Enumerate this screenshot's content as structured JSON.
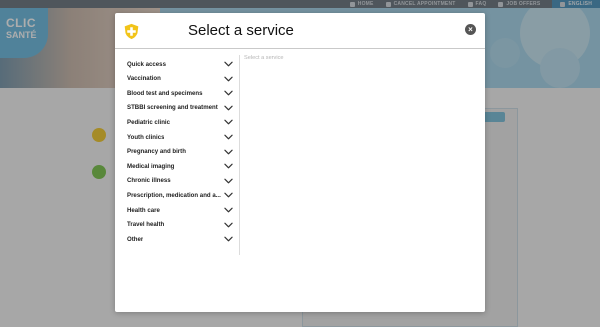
{
  "top_nav": {
    "home": "HOME",
    "cancel": "CANCEL APPOINTMENT",
    "faq": "FAQ",
    "jobs": "JOB OFFERS",
    "language": "ENGLISH"
  },
  "logo": {
    "line1": "CLIC",
    "line2": "SANTÉ"
  },
  "modal": {
    "title": "Select a service",
    "close_label": "×",
    "placeholder": "Select a service",
    "services": [
      {
        "label": "Quick access"
      },
      {
        "label": "Vaccination"
      },
      {
        "label": "Blood test and specimens"
      },
      {
        "label": "STBBI screening and treatment"
      },
      {
        "label": "Pediatric clinic"
      },
      {
        "label": "Youth clinics"
      },
      {
        "label": "Pregnancy and birth"
      },
      {
        "label": "Medical imaging"
      },
      {
        "label": "Chronic illness"
      },
      {
        "label": "Prescription, medication and a..."
      },
      {
        "label": "Health care"
      },
      {
        "label": "Travel health"
      },
      {
        "label": "Other"
      }
    ]
  },
  "colors": {
    "accent_yellow": "#f2c419",
    "accent_green": "#6fbf3b",
    "brand_blue": "#5fb6de",
    "top_bar": "#5e6a74"
  }
}
